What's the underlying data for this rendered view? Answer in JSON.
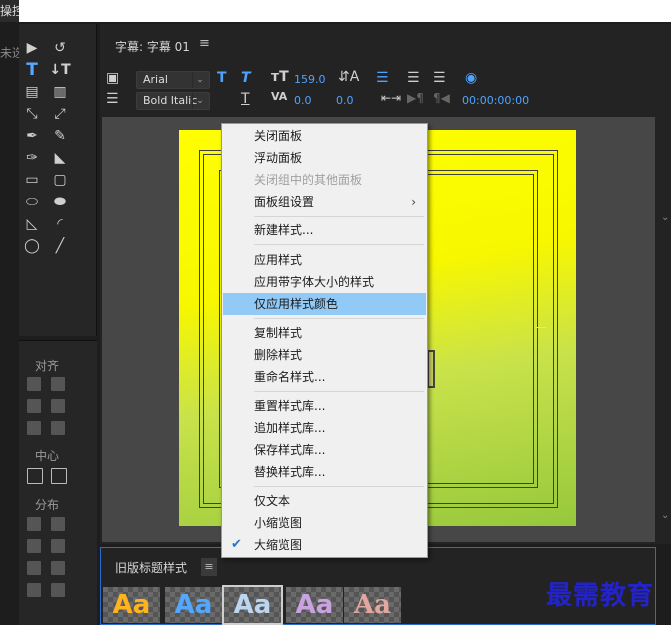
{
  "topstrip": {
    "tab_fragment": "操控",
    "left_title_fragment": "未选"
  },
  "main_panel": {
    "title": "字幕: 字幕 01",
    "menu_icon": "hamburger-icon"
  },
  "toolbar": {
    "font_family": "Arial",
    "font_style": "Bold Italic",
    "font_size": "159.0",
    "leading": "0.0",
    "kerning_value": "0.0",
    "tab_time": "00:00:00:00"
  },
  "align_panel": {
    "align_label": "对齐",
    "center_label": "中心",
    "distribute_label": "分布"
  },
  "styles_panel": {
    "title": "旧版标题样式",
    "thumb_text": "Aa"
  },
  "context_menu": {
    "items": [
      {
        "label": "关闭面板"
      },
      {
        "label": "浮动面板"
      },
      {
        "label": "关闭组中的其他面板"
      },
      {
        "label": "面板组设置"
      },
      {
        "label": "新建样式..."
      },
      {
        "label": "应用样式"
      },
      {
        "label": "应用带字体大小的样式"
      },
      {
        "label": "仅应用样式颜色"
      },
      {
        "label": "复制样式"
      },
      {
        "label": "删除样式"
      },
      {
        "label": "重命名样式..."
      },
      {
        "label": "重置样式库..."
      },
      {
        "label": "追加样式库..."
      },
      {
        "label": "保存样式库..."
      },
      {
        "label": "替换样式库..."
      },
      {
        "label": "仅文本"
      },
      {
        "label": "小缩览图"
      },
      {
        "label": "大缩览图"
      }
    ],
    "disabled_item": "关闭组中的其他面板",
    "highlighted_item": "仅应用样式颜色",
    "checked_item": "大缩览图"
  },
  "watermark": "最需教育",
  "colors": {
    "accent_blue": "#4ea3ff",
    "menu_highlight": "#91c9f7",
    "canvas_top": "#ffff00",
    "canvas_bottom": "#96c83c"
  }
}
